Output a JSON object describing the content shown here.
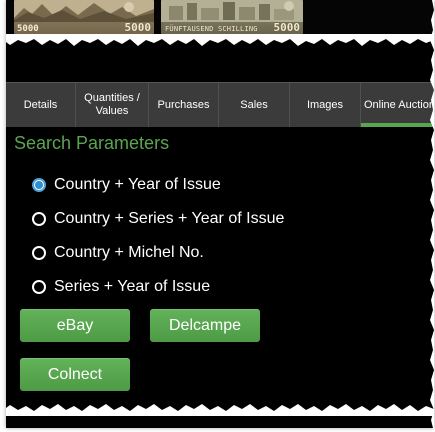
{
  "banknotes": [
    {
      "caption": "",
      "value_left": "5000",
      "value_right": "5000"
    },
    {
      "caption": "FÜNFTAUSEND SCHILLING",
      "value_left": "",
      "value_right": "5000"
    }
  ],
  "tabs": [
    {
      "label": "Details",
      "active": false
    },
    {
      "label": "Quantities / Values",
      "active": false
    },
    {
      "label": "Purchases",
      "active": false
    },
    {
      "label": "Sales",
      "active": false
    },
    {
      "label": "Images",
      "active": false
    },
    {
      "label": "Online Auction",
      "active": true
    }
  ],
  "section_title": "Search Parameters",
  "search_options": [
    {
      "label": "Country + Year of Issue",
      "selected": true
    },
    {
      "label": "Country + Series + Year of Issue",
      "selected": false
    },
    {
      "label": "Country + Michel No.",
      "selected": false
    },
    {
      "label": "Series + Year of Issue",
      "selected": false
    }
  ],
  "buttons": {
    "ebay": "eBay",
    "delcampe": "Delcampe",
    "colnect": "Colnect"
  },
  "colors": {
    "accent_green": "#5aa650",
    "radio_blue": "#2e8ece",
    "tab_bar": "#3b3b3b",
    "background": "#000000"
  }
}
